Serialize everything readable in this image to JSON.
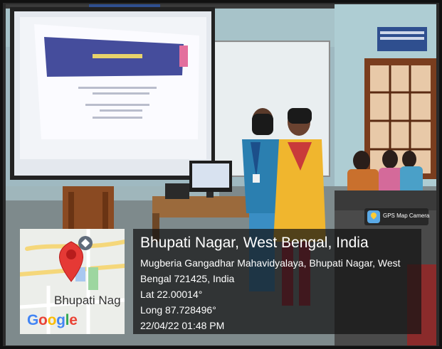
{
  "overlay": {
    "title": "Bhupati Nagar, West Bengal, India",
    "address_line1": "Mugberia Gangadhar Mahavidyalaya, Bhupati Nagar, West",
    "address_line2": "Bengal 721425, India",
    "lat": "Lat 22.00014°",
    "long": "Long 87.728496°",
    "datetime": "22/04/22 01:48 PM"
  },
  "map": {
    "place_label": "Bhupati Nag",
    "logo_text": "Google",
    "marker_color": "#e53935"
  },
  "badge": {
    "label": "GPS Map Camera"
  }
}
